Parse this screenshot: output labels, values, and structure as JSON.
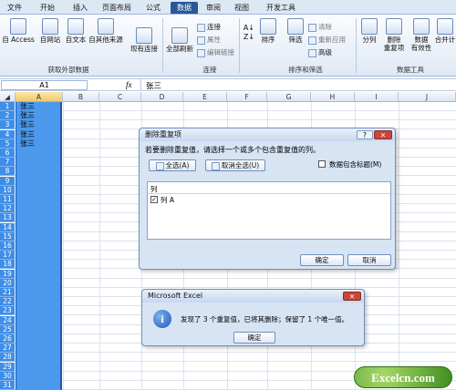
{
  "tabs": [
    "文件",
    "开始",
    "插入",
    "页面布局",
    "公式",
    "数据",
    "审阅",
    "视图",
    "开发工具"
  ],
  "ribbon": {
    "from_access": "自 Access",
    "from_web": "自网站",
    "from_text": "自文本",
    "from_other": "自其他来源",
    "existing": "现有连接",
    "group_external": "获取外部数据",
    "refresh_all": "全部刷新",
    "connections": "连接",
    "properties": "属性",
    "edit_links": "编辑链接",
    "group_connections": "连接",
    "sort": "排序",
    "filter": "筛选",
    "clear": "清除",
    "reapply": "重新应用",
    "advanced": "高级",
    "group_sort": "排序和筛选",
    "text_to_cols": "分列",
    "remove_dup": "删除\n重复项",
    "validation": "数据\n有效性",
    "consolidate": "合并计",
    "group_tools": "数据工具"
  },
  "formula_bar": {
    "name_box": "A1",
    "fx": "fx",
    "value": "张三"
  },
  "columns": [
    "A",
    "B",
    "C",
    "D",
    "E",
    "F",
    "G",
    "H",
    "I",
    "J"
  ],
  "rows": [
    "1",
    "2",
    "3",
    "4",
    "5",
    "6",
    "7",
    "8",
    "9",
    "10",
    "11",
    "12",
    "13",
    "14",
    "15",
    "16",
    "17",
    "18",
    "19",
    "20",
    "21",
    "22",
    "23",
    "24",
    "25",
    "26",
    "27",
    "28",
    "29",
    "30",
    "31"
  ],
  "cells_A": [
    "张三",
    "张三",
    "张三",
    "张三",
    "张三"
  ],
  "dialog_dup": {
    "title": "删除重复项",
    "help": "?",
    "close": "✕",
    "instruction": "若要删除重复值，请选择一个或多个包含重复值的列。",
    "select_all": "全选(A)",
    "unselect_all": "取消全选(U)",
    "header_checkbox": "数据包含标题(M)",
    "list_header": "列",
    "list_item": "列 A",
    "ok": "确定",
    "cancel": "取消"
  },
  "dialog_msg": {
    "title": "Microsoft Excel",
    "close": "✕",
    "icon": "i",
    "message": "发现了 3 个重复值，已将其删除；保留了 1 个唯一值。",
    "ok": "确定"
  },
  "watermark": "Excelcn.com"
}
